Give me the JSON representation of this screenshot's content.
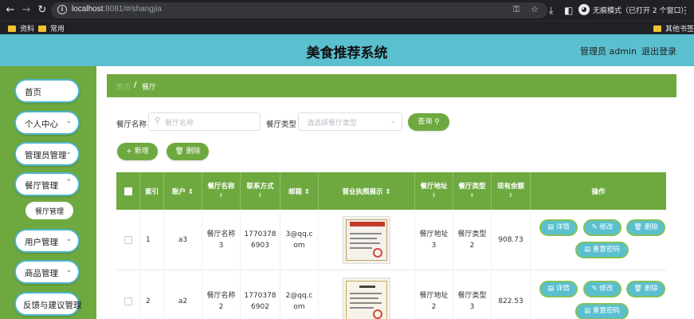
{
  "browser": {
    "url_host": "localhost",
    "url_rest": ":8081/#/shangjia",
    "incognito_label": "无痕模式（已打开 2 个窗口）",
    "bookmarks": [
      "资料",
      "常用"
    ],
    "other_bookmarks": "其他书签"
  },
  "header": {
    "title": "美食推荐系统",
    "user": "管理员 admin",
    "logout": "退出登录"
  },
  "sidebar": {
    "items": [
      {
        "label": "首页"
      },
      {
        "label": "个人中心"
      },
      {
        "label": "管理员管理"
      },
      {
        "label": "餐厅管理"
      },
      {
        "label": "餐厅管理"
      },
      {
        "label": "用户管理"
      },
      {
        "label": "商品管理"
      },
      {
        "label": "反馈与建议管理"
      }
    ]
  },
  "breadcrumb": {
    "home": "首页",
    "separator": "/",
    "current": "餐厅"
  },
  "search": {
    "name_label": "餐厅名称",
    "name_placeholder": "餐厅名称",
    "type_label": "餐厅类型",
    "type_placeholder": "请选择餐厅类型",
    "query_button": "查询"
  },
  "actions": {
    "add": "新增",
    "delete": "删除"
  },
  "table": {
    "headers": [
      "索引",
      "账户",
      "餐厅名称",
      "联系方式",
      "邮箱",
      "营业执照展示",
      "餐厅地址",
      "餐厅类型",
      "现有余额",
      "操作"
    ],
    "rows": [
      {
        "index": "1",
        "account": "a3",
        "name_1": "餐厅名称",
        "name_2": "3",
        "phone_1": "1770378",
        "phone_2": "6903",
        "email_1": "3@qq.c",
        "email_2": "om",
        "addr_1": "餐厅地址",
        "addr_2": "3",
        "type_1": "餐厅类型",
        "type_2": "2",
        "balance": "908.73"
      },
      {
        "index": "2",
        "account": "a2",
        "name_1": "餐厅名称",
        "name_2": "2",
        "phone_1": "1770378",
        "phone_2": "6902",
        "email_1": "2@qq.c",
        "email_2": "om",
        "addr_1": "餐厅地址",
        "addr_2": "2",
        "type_1": "餐厅类型",
        "type_2": "3",
        "balance": "822.53"
      }
    ],
    "ops": {
      "detail": "详情",
      "edit": "修改",
      "delete": "删除",
      "reset_password": "重置密码"
    }
  },
  "colors": {
    "header_teal": "#5abfcf",
    "sidebar_green": "#6ea940",
    "button_green": "#6ea940",
    "op_button_teal": "#5abfcf"
  }
}
